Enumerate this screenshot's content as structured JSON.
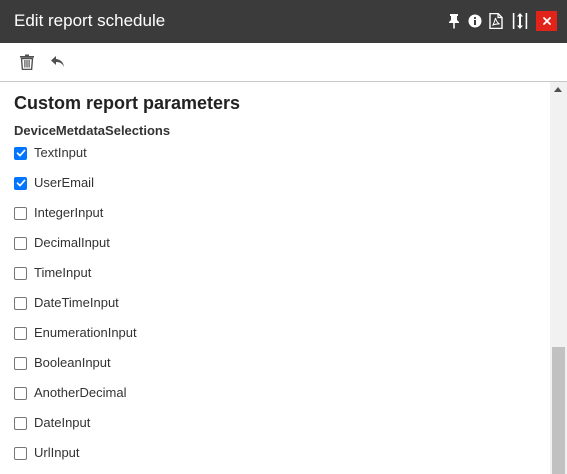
{
  "window": {
    "title": "Edit report schedule",
    "titlebar_icons": [
      "pin-icon",
      "info-icon",
      "pdf-icon",
      "resize-icon",
      "close-icon"
    ],
    "close_color": "#e2231a",
    "titlebar_color": "#3b3b3b"
  },
  "toolbar": {
    "items": [
      "trash-icon",
      "undo-icon"
    ]
  },
  "main": {
    "section_title": "Custom report parameters",
    "group_label": "DeviceMetdataSelections",
    "checkboxes": [
      {
        "label": "TextInput",
        "checked": true
      },
      {
        "label": "UserEmail",
        "checked": true
      },
      {
        "label": "IntegerInput",
        "checked": false
      },
      {
        "label": "DecimalInput",
        "checked": false
      },
      {
        "label": "TimeInput",
        "checked": false
      },
      {
        "label": "DateTimeInput",
        "checked": false
      },
      {
        "label": "EnumerationInput",
        "checked": false
      },
      {
        "label": "BooleanInput",
        "checked": false
      },
      {
        "label": "AnotherDecimal",
        "checked": false
      },
      {
        "label": "DateInput",
        "checked": false
      },
      {
        "label": "UrlInput",
        "checked": false
      }
    ],
    "checkbox_accent": "#0075ff"
  }
}
